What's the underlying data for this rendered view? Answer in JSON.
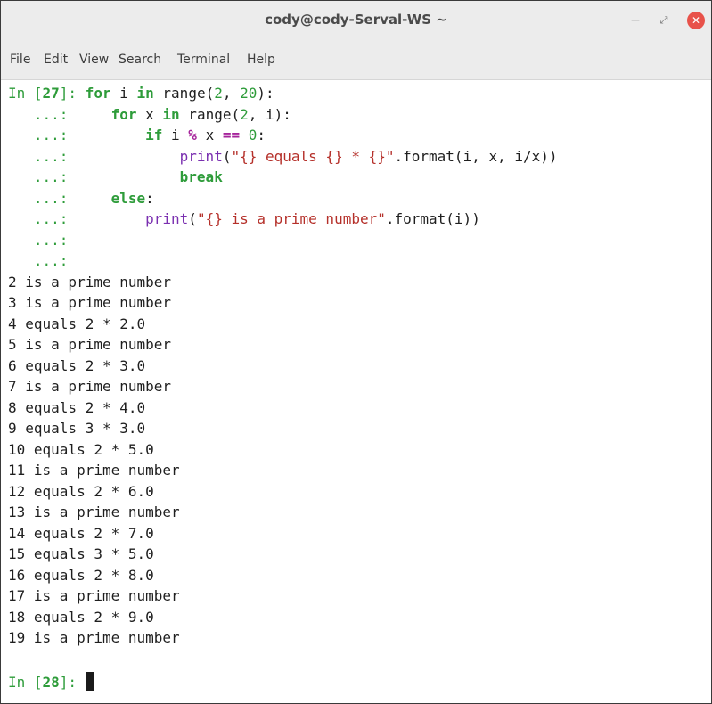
{
  "window": {
    "title": "cody@cody-Serval-WS ~"
  },
  "menu": {
    "items": [
      "File",
      "Edit",
      "View",
      "Search",
      "Terminal",
      "Help"
    ]
  },
  "input": {
    "prompt_label": "In [",
    "prompt_num": "27",
    "prompt_end": "]: ",
    "line1": {
      "k_for": "for",
      "var_i": " i ",
      "k_in": "in",
      "fn": " range",
      "lp": "(",
      "n2": "2",
      "comma": ", ",
      "n20": "20",
      "rp": "):"
    },
    "cont": "   ...: ",
    "line2": {
      "indent": "    ",
      "k_for": "for",
      "var_x": " x ",
      "k_in": "in",
      "fn": " range",
      "lp": "(",
      "n2": "2",
      "rest": ", i):"
    },
    "line3": {
      "indent": "        ",
      "k_if": "if",
      "expr": " i ",
      "op": "%",
      "expr2": " x ",
      "eq": "==",
      "sp": " ",
      "n0": "0",
      "colon": ":"
    },
    "line4": {
      "indent": "            ",
      "fn": "print",
      "lp": "(",
      "str": "\"{} equals {} * {}\"",
      "rest": ".format(i, x, i/x))"
    },
    "line5": {
      "indent": "            ",
      "k_break": "break"
    },
    "line6": {
      "indent": "    ",
      "k_else": "else",
      "colon": ":"
    },
    "line7": {
      "indent": "        ",
      "fn": "print",
      "lp": "(",
      "str": "\"{} is a prime number\"",
      "rest": ".format(i))"
    }
  },
  "output": [
    "2 is a prime number",
    "3 is a prime number",
    "4 equals 2 * 2.0",
    "5 is a prime number",
    "6 equals 2 * 3.0",
    "7 is a prime number",
    "8 equals 2 * 4.0",
    "9 equals 3 * 3.0",
    "10 equals 2 * 5.0",
    "11 is a prime number",
    "12 equals 2 * 6.0",
    "13 is a prime number",
    "14 equals 2 * 7.0",
    "15 equals 3 * 5.0",
    "16 equals 2 * 8.0",
    "17 is a prime number",
    "18 equals 2 * 9.0",
    "19 is a prime number"
  ],
  "next_prompt": {
    "label": "In [",
    "num": "28",
    "end": "]: "
  },
  "window_buttons": {
    "minimize": "−",
    "maximize": "⤢",
    "close": "✕"
  }
}
